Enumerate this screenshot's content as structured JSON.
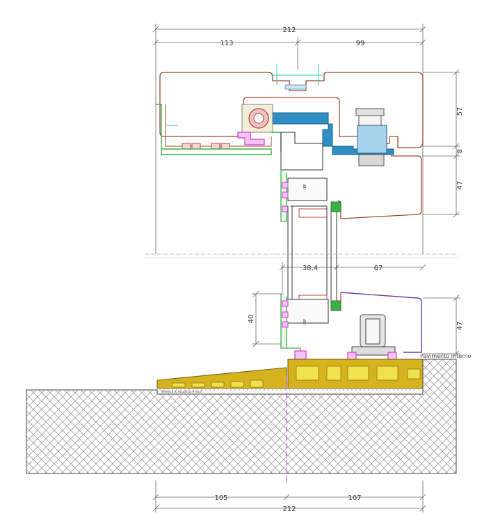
{
  "dimensions": {
    "top_overall": "212",
    "top_left": "113",
    "top_right": "99",
    "right_upper": "57",
    "right_gap": "8",
    "right_middle": "47",
    "mid_left": "38,4",
    "mid_right": "67",
    "left_height": "40",
    "right_lower": "47",
    "bottom_left": "105",
    "bottom_right": "107",
    "bottom_overall": "212"
  },
  "labels": {
    "floor_note": "Pavimento Interno",
    "small_tag_upper": "IBP",
    "small_tag_lower": "IBP",
    "sill_print": "Termica & Acustica A muri"
  },
  "colors": {
    "frame_outline": "#9a4a2a",
    "blue_profile": "#2f8fc4",
    "green_gasket": "#3cb043",
    "magenta_gasket": "#d63ad6",
    "sill_fill": "#d6b21e",
    "concrete_hatch": "#777777",
    "dim_line": "#555555",
    "cyan_axis": "#22c4c4",
    "purple_outline": "#6a3da8"
  }
}
